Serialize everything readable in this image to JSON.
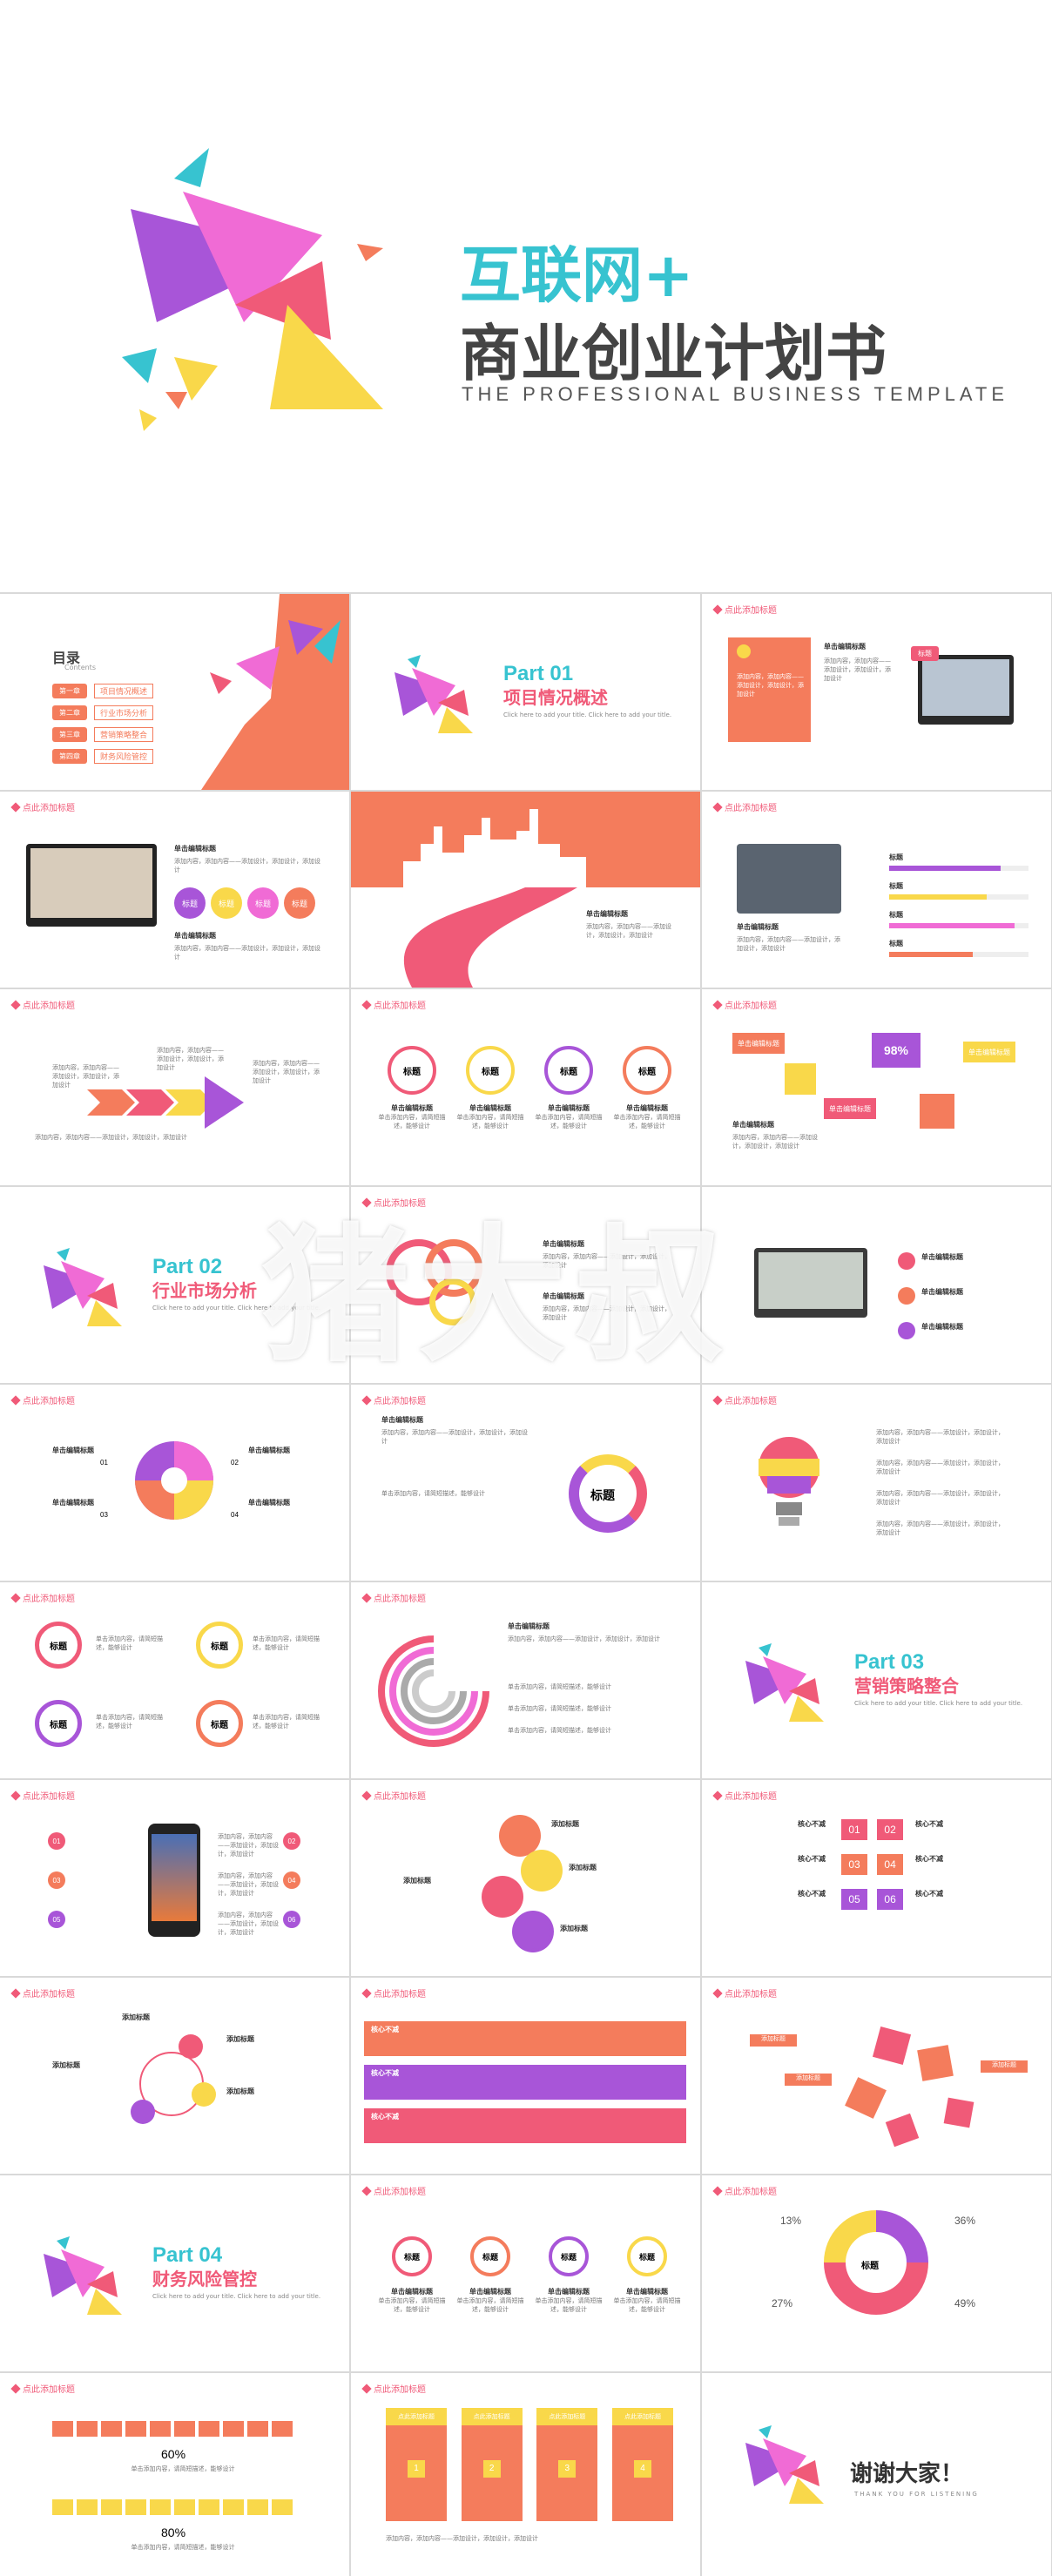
{
  "cover": {
    "title_line1": "互联网+",
    "title_line2": "商业创业计划书",
    "subtitle": "THE PROFESSIONAL BUSINESS TEMPLATE"
  },
  "slide_title": "点此添加标题",
  "toc": {
    "title": "目录",
    "subtitle": "Contents",
    "items": [
      {
        "num": "第一章",
        "label": "项目情况概述"
      },
      {
        "num": "第二章",
        "label": "行业市场分析"
      },
      {
        "num": "第三章",
        "label": "营销策略整合"
      },
      {
        "num": "第四章",
        "label": "财务风险管控"
      }
    ]
  },
  "parts": [
    {
      "num": "Part  01",
      "title": "项目情况概述",
      "desc": "Click here to add your title. Click here to add your title."
    },
    {
      "num": "Part  02",
      "title": "行业市场分析",
      "desc": "Click here to add your title. Click here to add your title."
    },
    {
      "num": "Part  03",
      "title": "营销策略整合",
      "desc": "Click here to add your title. Click here to add your title."
    },
    {
      "num": "Part  04",
      "title": "财务风险管控",
      "desc": "Click here to add your title. Click here to add your title."
    }
  ],
  "labels": {
    "heading": "单击编辑标题",
    "tag": "标题",
    "body": "添加内容，添加内容——添加设计，添加设计，添加设计",
    "body_short": "单击添加内容，请简短描述，能够设计",
    "add_title": "添加标题",
    "core": "核心不减"
  },
  "percents": {
    "p98": "98%",
    "p60": "60%",
    "p80": "80%",
    "p13": "13%",
    "p36": "36%",
    "p27": "27%",
    "p49": "49%"
  },
  "numbers": [
    "01",
    "02",
    "03",
    "04",
    "05",
    "06"
  ],
  "steps": [
    "1",
    "2",
    "3",
    "4"
  ],
  "thanks": {
    "title": "谢谢大家！",
    "subtitle": "THANK YOU  FOR  LISTENING"
  },
  "watermark": "猪大叔",
  "colors": {
    "pink": "#f05a78",
    "cyan": "#37c3d0",
    "purple": "#a855d8",
    "yellow": "#f9d84a",
    "orange": "#f47c5c",
    "magenta": "#e640a8"
  }
}
